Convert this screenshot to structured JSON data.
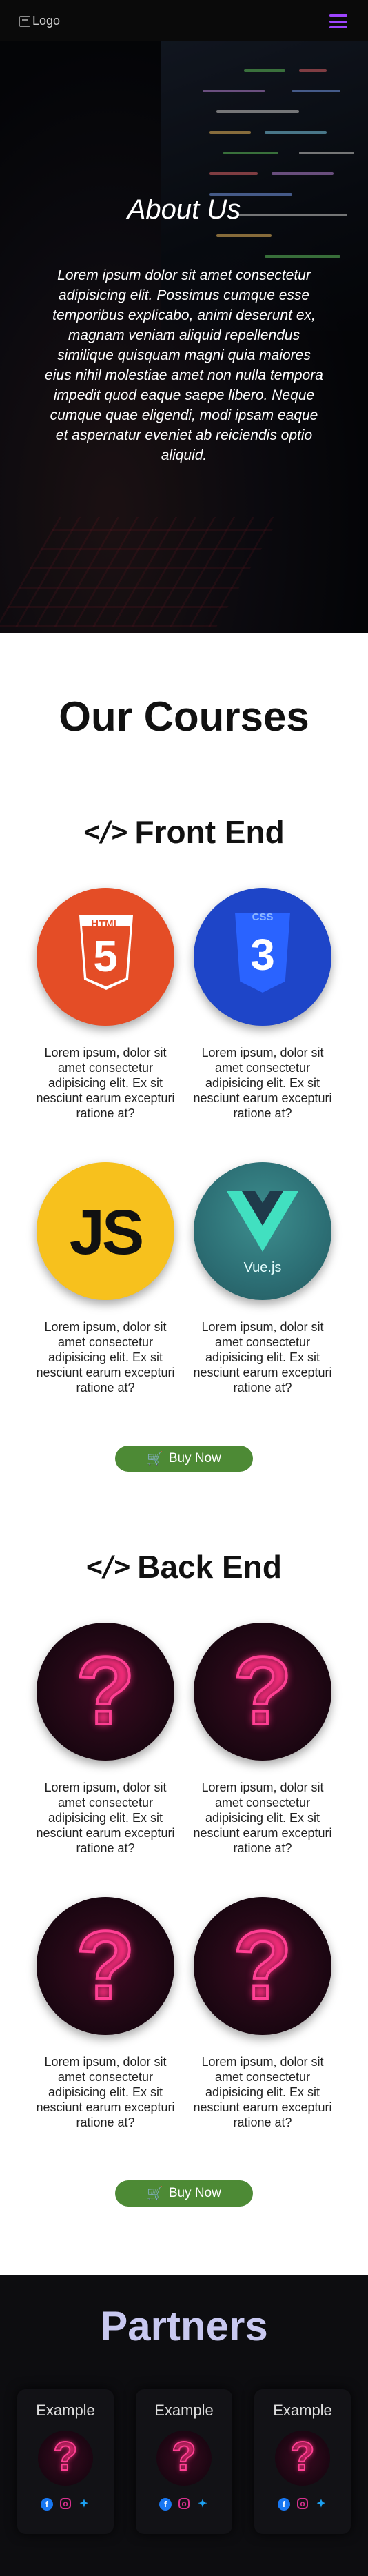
{
  "nav": {
    "logo_alt": "Logo",
    "menu_icon": "hamburger-icon",
    "accent_color": "#9e45ff"
  },
  "hero": {
    "title": "About Us",
    "text_lines": [
      "Lorem ipsum dolor sit amet consectetur",
      "adipisicing elit. Possimus cumque esse",
      "temporibus explicabo, animi deserunt ex,",
      "magnam veniam aliquid repellendus",
      "similique quisquam magni quia maiores",
      "eius nihil molestiae amet non nulla tempora",
      "impedit quod eaque saepe libero. Neque",
      "cumque quae eligendi, modi ipsam eaque",
      "et aspernatur eveniet ab reiciendis optio",
      "aliquid."
    ]
  },
  "courses": {
    "title": "Our Courses",
    "front_end": {
      "heading": "Front End",
      "icon": "code-icon",
      "cards": [
        {
          "logo": "HTML5",
          "logo_text": "HTML",
          "logo_num": "5",
          "icon": "html5-logo-icon",
          "text": "Lorem ipsum, dolor sit amet consectetur adipisicing elit. Ex sit nesciunt earum excepturi ratione at?"
        },
        {
          "logo": "CSS3",
          "logo_text": "CSS",
          "logo_num": "3",
          "icon": "css3-logo-icon",
          "text": "Lorem ipsum, dolor sit amet consectetur adipisicing elit. Ex sit nesciunt earum excepturi ratione at?"
        },
        {
          "logo": "JS",
          "logo_text": "JS",
          "icon": "javascript-logo-icon",
          "text": "Lorem ipsum, dolor sit amet consectetur adipisicing elit. Ex sit nesciunt earum excepturi ratione at?"
        },
        {
          "logo": "Vue.js",
          "logo_text": "Vue.js",
          "icon": "vue-logo-icon",
          "text": "Lorem ipsum, dolor sit amet consectetur adipisicing elit. Ex sit nesciunt earum excepturi ratione at?"
        }
      ],
      "button_label": "Buy Now",
      "button_icon": "cart-icon"
    },
    "back_end": {
      "heading": "Back End",
      "icon": "code-icon",
      "cards": [
        {
          "logo": "?",
          "icon": "question-mark-icon",
          "text": "Lorem ipsum, dolor sit amet consectetur adipisicing elit. Ex sit nesciunt earum excepturi ratione at?"
        },
        {
          "logo": "?",
          "icon": "question-mark-icon",
          "text": "Lorem ipsum, dolor sit amet consectetur adipisicing elit. Ex sit nesciunt earum excepturi ratione at?"
        },
        {
          "logo": "?",
          "icon": "question-mark-icon",
          "text": "Lorem ipsum, dolor sit amet consectetur adipisicing elit. Ex sit nesciunt earum excepturi ratione at?"
        },
        {
          "logo": "?",
          "icon": "question-mark-icon",
          "text": "Lorem ipsum, dolor sit amet consectetur adipisicing elit. Ex sit nesciunt earum excepturi ratione at?"
        }
      ],
      "button_label": "Buy Now",
      "button_icon": "cart-icon"
    },
    "button_color": "#4d8a35"
  },
  "partners": {
    "title": "Partners",
    "items": [
      {
        "name": "Example",
        "logo": "?",
        "socials": [
          "facebook-icon",
          "instagram-icon",
          "twitter-icon"
        ]
      },
      {
        "name": "Example",
        "logo": "?",
        "socials": [
          "facebook-icon",
          "instagram-icon",
          "twitter-icon"
        ]
      },
      {
        "name": "Example",
        "logo": "?",
        "socials": [
          "facebook-icon",
          "instagram-icon",
          "twitter-icon"
        ]
      }
    ]
  }
}
